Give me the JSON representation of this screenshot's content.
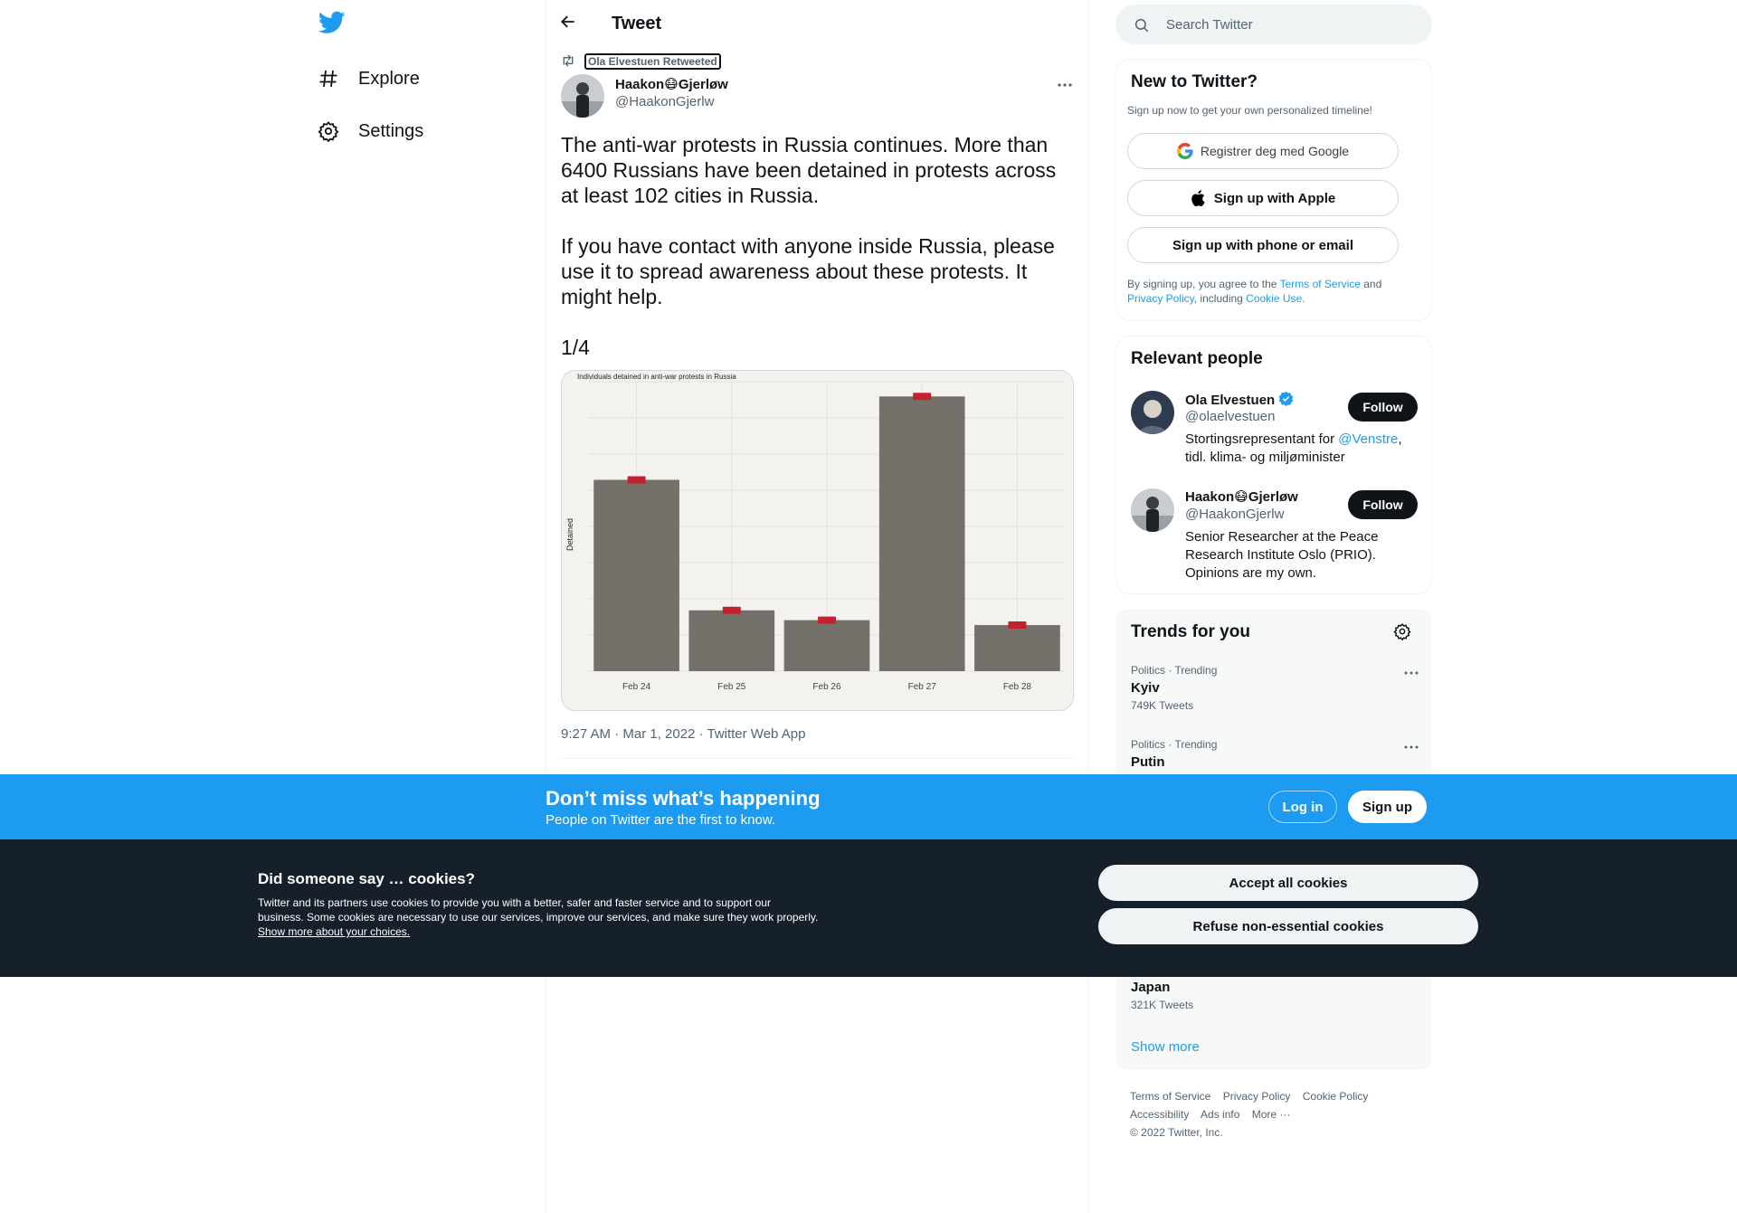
{
  "nav": {
    "logo": "twitter-bird-icon",
    "items": [
      {
        "label": "Explore",
        "icon": "hashtag-icon"
      },
      {
        "label": "Settings",
        "icon": "gear-icon"
      }
    ]
  },
  "header": {
    "title": "Tweet",
    "back_icon": "arrow-left-icon"
  },
  "tweet": {
    "retweeted_by": "Ola Elvestuen Retweeted",
    "author_name": "Haakon😷Gjerløw",
    "author_handle": "@HaakonGjerlw",
    "paragraphs": [
      "The anti-war protests in Russia continues. More than 6400 Russians have been detained in protests across at least 102 cities in Russia.",
      "If you have contact with anyone inside Russia, please use it to spread awareness about these protests. It might help.",
      "1/4"
    ],
    "meta": "9:27 AM · Mar 1, 2022 · Twitter Web App"
  },
  "chart_data": {
    "type": "bar",
    "title": "Individuals detained in anti-war protests in Russia",
    "xlabel": "",
    "ylabel": "Detained",
    "categories": [
      "Feb 24",
      "Feb 25",
      "Feb 26",
      "Feb 27",
      "Feb 28"
    ],
    "values": [
      1950,
      620,
      520,
      2800,
      470
    ],
    "data_labels": [
      "",
      "",
      "",
      "",
      ""
    ],
    "ylim": [
      0,
      2950
    ],
    "grid": true,
    "bar_color": "#74716b",
    "label_color": "#c0222e"
  },
  "search": {
    "placeholder": "Search Twitter"
  },
  "signup": {
    "title": "New to Twitter?",
    "subtitle": "Sign up now to get your own personalized timeline!",
    "google": "Registrer deg med Google",
    "apple": "Sign up with Apple",
    "phone": "Sign up with phone or email",
    "legal_1": "By signing up, you agree to the ",
    "legal_tos": "Terms of Service",
    "legal_2": " and ",
    "legal_privacy": "Privacy Policy",
    "legal_3": ", including ",
    "legal_cookie": "Cookie Use."
  },
  "relevant": {
    "title": "Relevant people",
    "people": [
      {
        "name": "Ola Elvestuen",
        "handle": "@olaelvestuen",
        "verified": true,
        "bio_1": "Stortingsrepresentant for ",
        "bio_link": "@Venstre",
        "bio_2": ", tidl. klima- og miljøminister",
        "follow": "Follow"
      },
      {
        "name": "Haakon😷Gjerløw",
        "handle": "@HaakonGjerlw",
        "verified": false,
        "bio_1": "Senior Researcher at the Peace Research Institute Oslo (PRIO). Opinions are my own.",
        "bio_link": "",
        "bio_2": "",
        "follow": "Follow"
      }
    ]
  },
  "trends": {
    "title": "Trends for you",
    "items": [
      {
        "category": "Politics · Trending",
        "name": "Kyiv",
        "count": "749K Tweets"
      },
      {
        "category": "Politics · Trending",
        "name": "Putin",
        "count": ""
      },
      {
        "category": "",
        "name": "Japan",
        "count": "321K Tweets"
      }
    ],
    "show_more": "Show more"
  },
  "footer": {
    "links": [
      "Terms of Service",
      "Privacy Policy",
      "Cookie Policy",
      "Accessibility",
      "Ads info",
      "More ···"
    ],
    "copyright": "© 2022 Twitter, Inc."
  },
  "banner": {
    "title": "Don’t miss what’s happening",
    "subtitle": "People on Twitter are the first to know.",
    "login": "Log in",
    "signup": "Sign up"
  },
  "cookie": {
    "title": "Did someone say … cookies?",
    "text": "Twitter and its partners use cookies to provide you with a better, safer and faster service and to support our business. Some cookies are necessary to use our services, improve our services, and make sure they work properly. ",
    "link": "Show more about your choices.",
    "accept": "Accept all cookies",
    "refuse": "Refuse non-essential cookies"
  },
  "colors": {
    "brand": "#1d9bf0",
    "text": "#0f1419",
    "muted": "#536471",
    "cookie_bg": "#15202b"
  }
}
